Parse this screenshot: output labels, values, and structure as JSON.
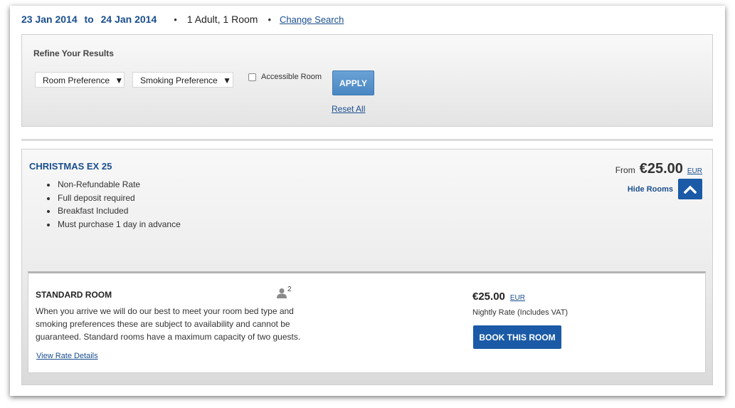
{
  "search": {
    "check_in": "23 Jan 2014",
    "to_label": "to",
    "check_out": "24 Jan 2014",
    "occupancy": "1 Adult, 1 Room",
    "change_search": "Change Search"
  },
  "refine": {
    "title": "Refine Your Results",
    "room_pref": "Room Preference",
    "smoking_pref": "Smoking Preference",
    "dropdown_arrow": "▼",
    "accessible_label": "Accessible Room",
    "apply_label": "APPLY",
    "reset_label": "Reset All"
  },
  "rate": {
    "name": "CHRISTMAS EX 25",
    "features": [
      "Non-Refundable Rate",
      "Full deposit required",
      "Breakfast Included",
      "Must purchase 1 day in advance"
    ],
    "from_label": "From",
    "price": "€25.00",
    "currency": "EUR",
    "hide_rooms_label": "Hide Rooms"
  },
  "room": {
    "title": "STANDARD ROOM",
    "capacity": "2",
    "description": "When you arrive we will do our best to meet your room bed type and smoking preferences these are subject to availability and cannot be guaranteed. Standard rooms have a maximum capacity of two guests.",
    "view_rate_details": "View Rate Details",
    "price": "€25.00",
    "currency": "EUR",
    "nightly_label": "Nightly Rate (Includes VAT)",
    "book_label": "BOOK THIS ROOM"
  },
  "colors": {
    "brand_blue": "#1a4e8e",
    "button_blue": "#1a5aa6",
    "apply_blue": "#5a94cc"
  }
}
